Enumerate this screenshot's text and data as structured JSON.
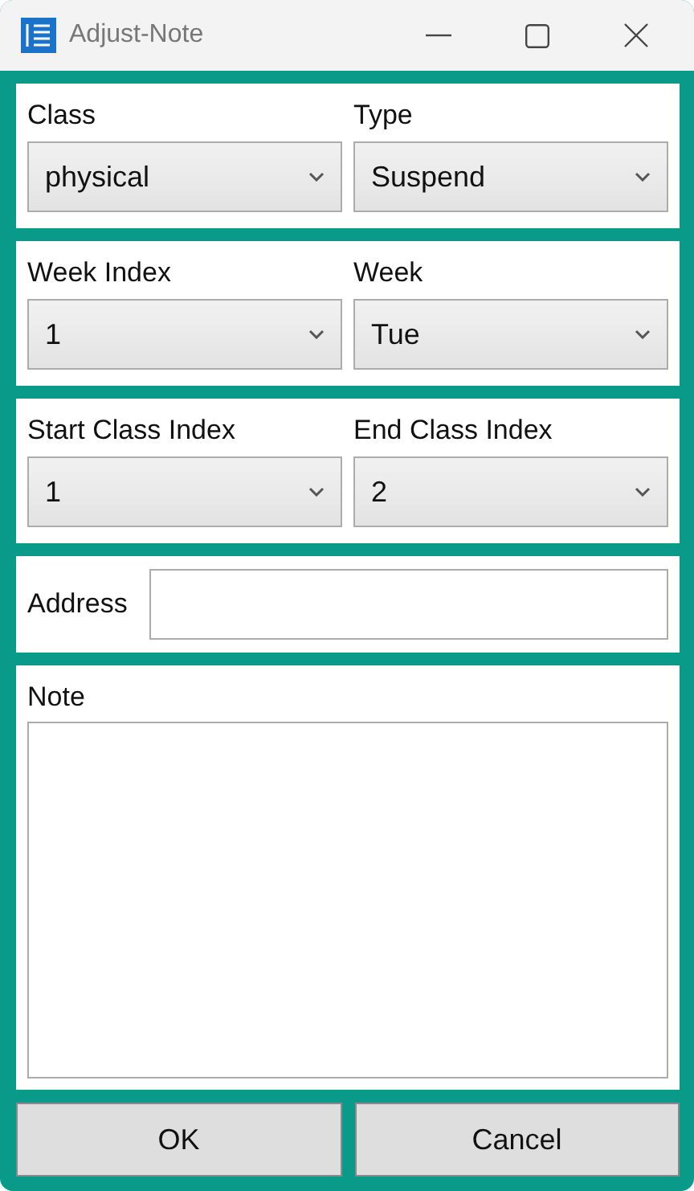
{
  "window": {
    "title": "Adjust-Note"
  },
  "dropdown_rows": [
    {
      "fields": [
        {
          "label": "Class",
          "value": "physical"
        },
        {
          "label": "Type",
          "value": "Suspend"
        }
      ]
    },
    {
      "fields": [
        {
          "label": "Week Index",
          "value": "1"
        },
        {
          "label": "Week",
          "value": "Tue"
        }
      ]
    },
    {
      "fields": [
        {
          "label": "Start Class Index",
          "value": "1"
        },
        {
          "label": "End Class Index",
          "value": "2"
        }
      ]
    }
  ],
  "address": {
    "label": "Address"
  },
  "note": {
    "label": "Note"
  },
  "buttons": [
    "OK",
    "Cancel"
  ]
}
